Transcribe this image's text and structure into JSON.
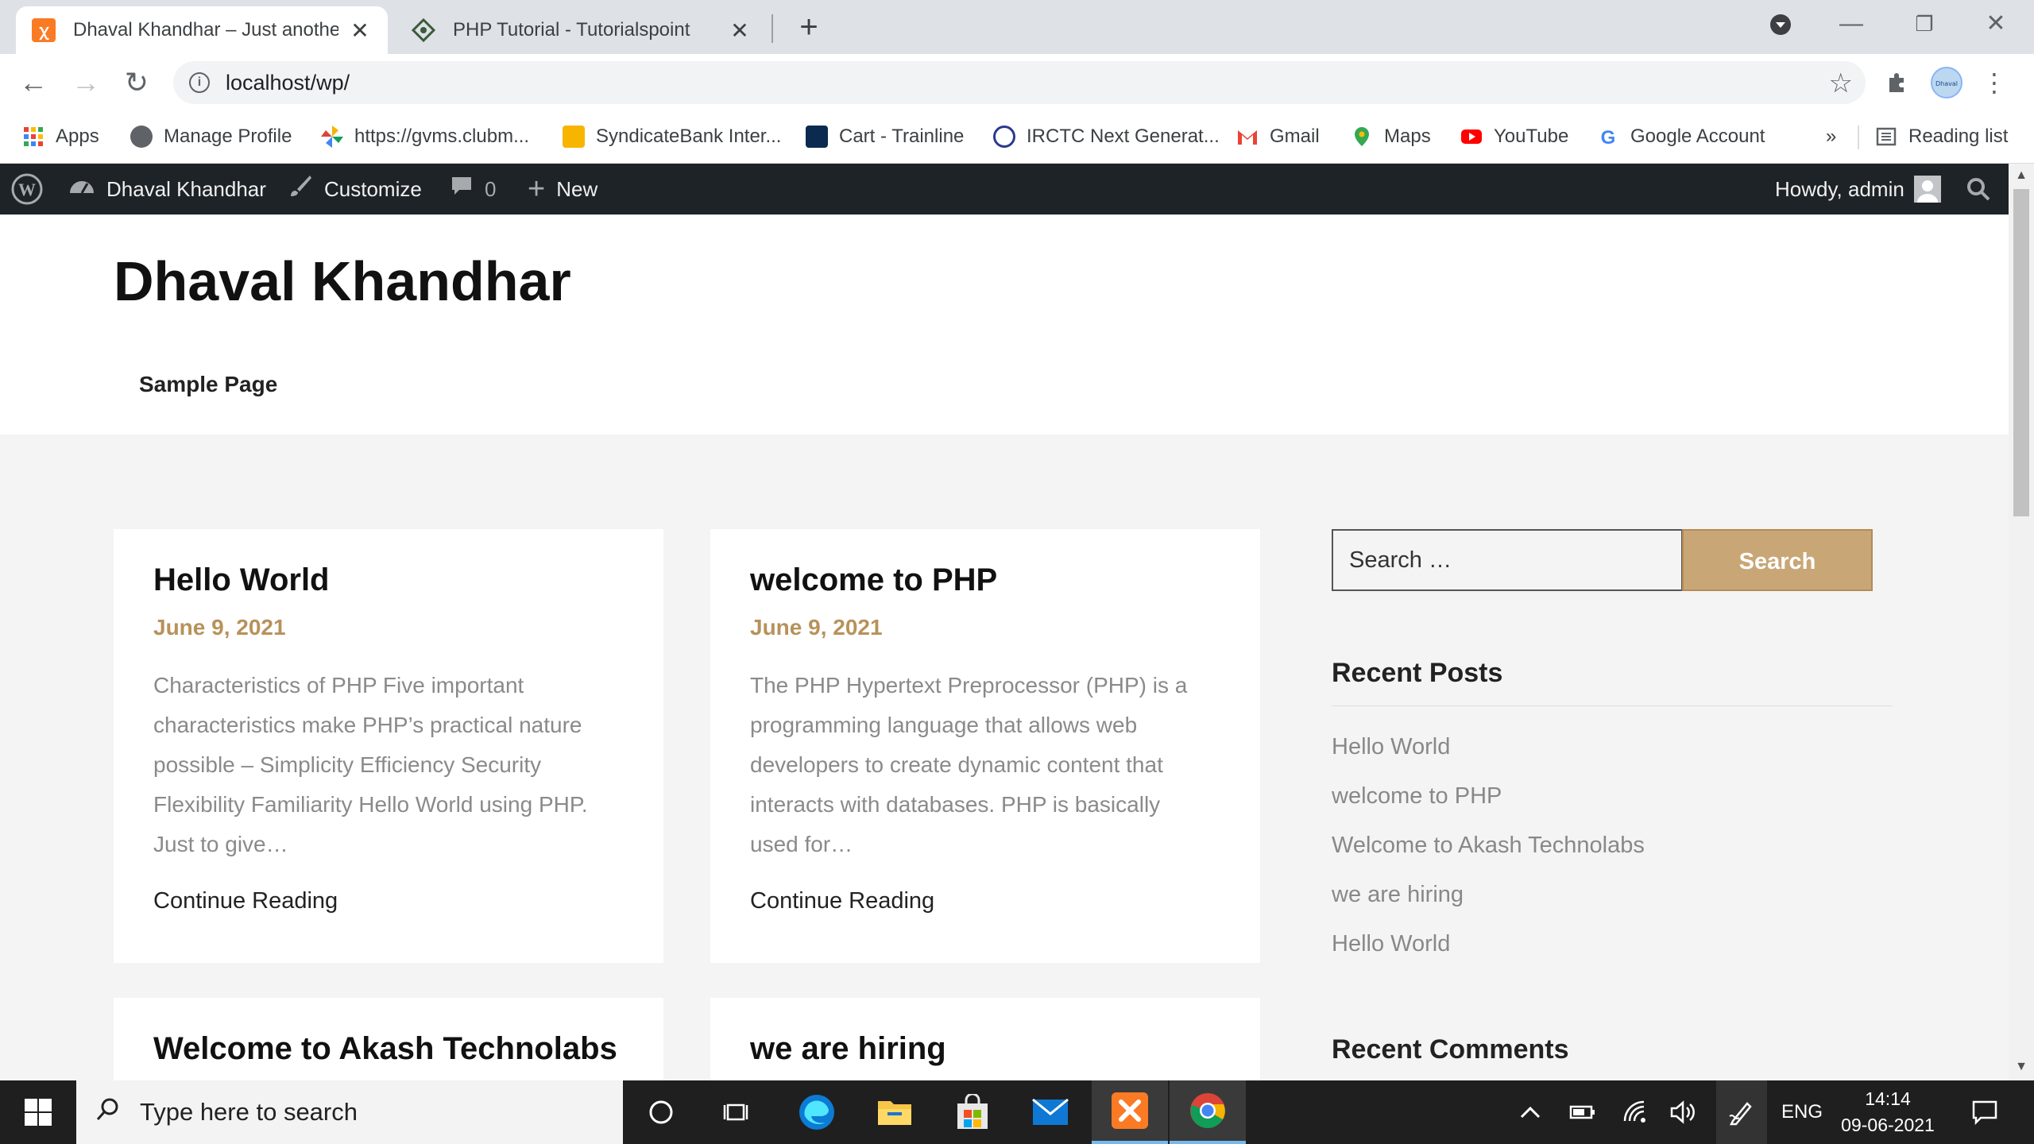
{
  "browser": {
    "tabs": [
      {
        "title": "Dhaval Khandhar – Just another WordPress site",
        "active": true
      },
      {
        "title": "PHP Tutorial - Tutorialspoint",
        "active": false
      }
    ],
    "url": "localhost/wp/",
    "bookmarks": [
      {
        "label": "Apps",
        "icon": "apps-grid-icon"
      },
      {
        "label": "Manage Profile",
        "icon": "globe-icon"
      },
      {
        "label": "https://gvms.clubm...",
        "icon": "pinwheel-icon"
      },
      {
        "label": "SyndicateBank Inter...",
        "icon": "syndicatebank-icon"
      },
      {
        "label": "Cart - Trainline",
        "icon": "trainline-icon"
      },
      {
        "label": "IRCTC Next Generat...",
        "icon": "irctc-icon"
      },
      {
        "label": "Gmail",
        "icon": "gmail-icon"
      },
      {
        "label": "Maps",
        "icon": "maps-icon"
      },
      {
        "label": "YouTube",
        "icon": "youtube-icon"
      },
      {
        "label": "Google Account",
        "icon": "google-icon"
      }
    ],
    "bookmarks_overflow": "»",
    "reading_list": "Reading list"
  },
  "adminbar": {
    "site_name": "Dhaval Khandhar",
    "customize": "Customize",
    "comments_count": "0",
    "new": "New",
    "howdy": "Howdy, admin"
  },
  "site": {
    "title": "Dhaval Khandhar",
    "nav": [
      "Sample Page"
    ]
  },
  "posts": [
    {
      "title": "Hello World",
      "date": "June 9, 2021",
      "excerpt": "Characteristics of PHP Five important characteristics make PHP’s practical nature possible – Simplicity Efficiency Security Flexibility Familiarity Hello World using PHP. Just to give…",
      "more": "Continue Reading"
    },
    {
      "title": "welcome to PHP",
      "date": "June 9, 2021",
      "excerpt": "The PHP Hypertext Preprocessor (PHP) is a programming language that allows web developers to create dynamic content that interacts with databases. PHP is basically used for…",
      "more": "Continue Reading"
    },
    {
      "title": "Welcome to Akash Technolabs"
    },
    {
      "title": "we are hiring"
    }
  ],
  "sidebar": {
    "search_placeholder": "Search …",
    "search_button": "Search",
    "recent_posts_title": "Recent Posts",
    "recent_posts": [
      "Hello World",
      "welcome to PHP",
      "Welcome to Akash Technolabs",
      "we are hiring",
      "Hello World"
    ],
    "recent_comments_title": "Recent Comments"
  },
  "taskbar": {
    "search_placeholder": "Type here to search",
    "language": "ENG",
    "time": "14:14",
    "date": "09-06-2021"
  },
  "colors": {
    "accent": "#b7925a",
    "search_button_bg": "#c9a676",
    "adminbar_bg": "#1d2327"
  }
}
